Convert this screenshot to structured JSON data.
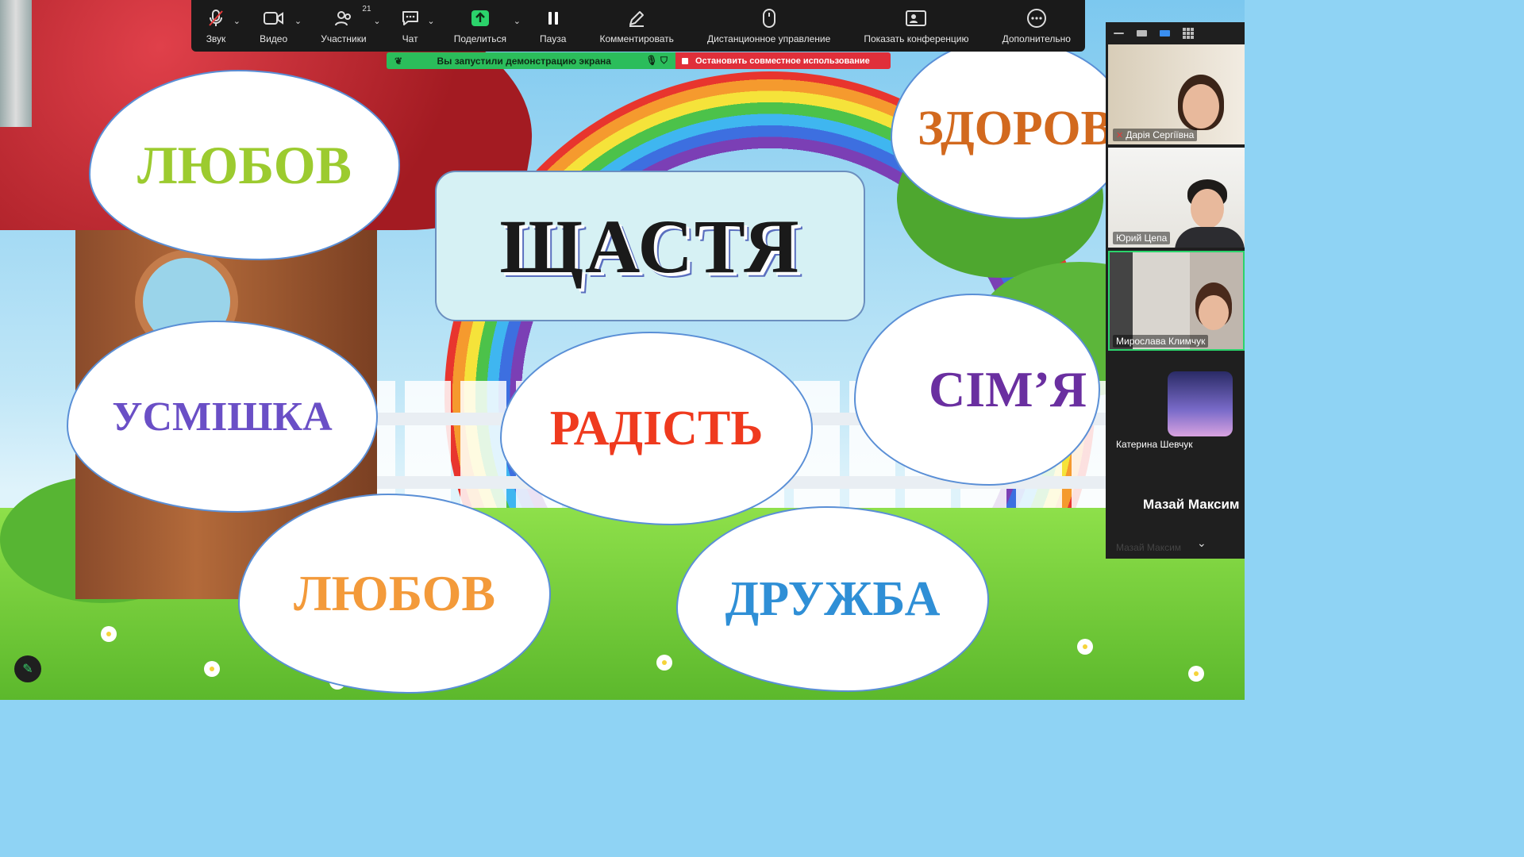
{
  "toolbar": {
    "items": [
      {
        "label": "Звук",
        "icon": "mic-muted-icon"
      },
      {
        "label": "Видео",
        "icon": "video-camera-icon"
      },
      {
        "label": "Участники",
        "icon": "participants-icon",
        "badge": "21"
      },
      {
        "label": "Чат",
        "icon": "chat-icon"
      },
      {
        "label": "Поделиться",
        "icon": "share-screen-icon"
      },
      {
        "label": "Пауза",
        "icon": "pause-icon"
      },
      {
        "label": "Комментировать",
        "icon": "annotate-pencil-icon"
      },
      {
        "label": "Дистанционное управление",
        "icon": "mouse-icon"
      },
      {
        "label": "Показать конференцию",
        "icon": "show-meeting-icon"
      },
      {
        "label": "Дополнительно",
        "icon": "more-icon"
      }
    ]
  },
  "share_bar": {
    "status": "Вы запустили демонстрацию экрана",
    "stop_label": "Остановить совместное использование"
  },
  "slide": {
    "title": "ЩАСТЯ",
    "words": [
      {
        "text": "ЛЮБОВ",
        "color": "#9ccb2f"
      },
      {
        "text": "ЗДОРОВ",
        "color": "#d2691e"
      },
      {
        "text": "УСМІШКА",
        "color": "#6a4fc6"
      },
      {
        "text": "РАДІСТЬ",
        "color": "#ef3a1e"
      },
      {
        "text": "СІМ’Я",
        "color": "#6a2fa0"
      },
      {
        "text": "ЛЮБОВ",
        "color": "#f39a3a"
      },
      {
        "text": "ДРУЖБА",
        "color": "#2f8fd6"
      }
    ]
  },
  "gallery": {
    "participants": [
      {
        "name": "Дарія Сергіївна",
        "muted": true
      },
      {
        "name": "Юрий Цепа",
        "muted": false
      },
      {
        "name": "Мирослава Климчук",
        "muted": false,
        "active": true
      },
      {
        "name": "Катерина Шевчук",
        "muted": false
      },
      {
        "name": "Мазай Максим",
        "muted": false
      }
    ]
  },
  "colors": {
    "toolbar_bg": "#1a1a1a",
    "share_green": "#2bbd5b",
    "stop_red": "#e02f3a",
    "active_speaker": "#2bd36b"
  }
}
